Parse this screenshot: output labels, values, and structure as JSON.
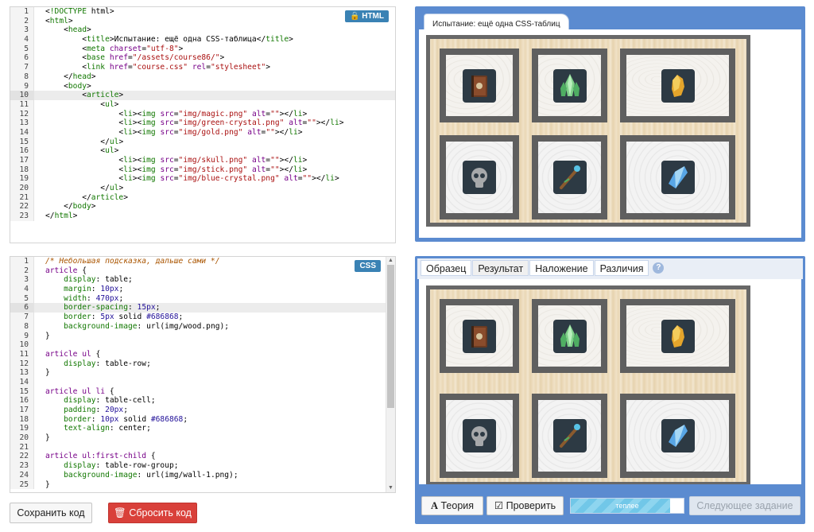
{
  "html_editor": {
    "badge": "HTML",
    "lines": [
      "<!DOCTYPE html>",
      "<html>",
      "    <head>",
      "        <title>Испытание: ещё одна CSS-таблица</title>",
      "        <meta charset=\"utf-8\">",
      "        <base href=\"/assets/course86/\">",
      "        <link href=\"course.css\" rel=\"stylesheet\">",
      "    </head>",
      "    <body>",
      "        <article>",
      "            <ul>",
      "                <li><img src=\"img/magic.png\" alt=\"\"></li>",
      "                <li><img src=\"img/green-crystal.png\" alt=\"\"></li>",
      "                <li><img src=\"img/gold.png\" alt=\"\"></li>",
      "            </ul>",
      "            <ul>",
      "                <li><img src=\"img/skull.png\" alt=\"\"></li>",
      "                <li><img src=\"img/stick.png\" alt=\"\"></li>",
      "                <li><img src=\"img/blue-crystal.png\" alt=\"\"></li>",
      "            </ul>",
      "        </article>",
      "    </body>",
      "</html>"
    ],
    "highlight_line": 10
  },
  "css_editor": {
    "badge": "CSS",
    "lines": [
      "/* Небольшая подсказка, дальше сами */",
      "article {",
      "    display: table;",
      "    margin: 10px;",
      "    width: 470px;",
      "    border-spacing: 15px;",
      "    border: 5px solid #686868;",
      "    background-image: url(img/wood.png);",
      "}",
      "",
      "article ul {",
      "    display: table-row;",
      "}",
      "",
      "article ul li {",
      "    display: table-cell;",
      "    padding: 20px;",
      "    border: 10px solid #686868;",
      "    text-align: center;",
      "}",
      "",
      "article ul:first-child {",
      "    display: table-row-group;",
      "    background-image: url(img/wall-1.png);",
      "}"
    ],
    "highlight_line": 6
  },
  "buttons": {
    "save": "Сохранить код",
    "reset": "Сбросить код",
    "theory": "Теория",
    "check": "Проверить",
    "next": "Следующее задание"
  },
  "preview_top": {
    "tab_title": "Испытание: ещё одна CSS-таблиц"
  },
  "preview_bottom": {
    "tabs": [
      "Образец",
      "Результат",
      "Наложение",
      "Различия"
    ],
    "active_tab": 1,
    "help": "?"
  },
  "progress": {
    "label": "теплее",
    "fraction": 0.88
  },
  "icons": [
    "magic-book-icon",
    "green-crystal-icon",
    "gold-nugget-icon",
    "skull-icon",
    "magic-stick-icon",
    "blue-crystal-icon"
  ],
  "colors": {
    "accent": "#5b8bd0",
    "badge": "#3a82b4",
    "reset": "#d9403a",
    "border": "#686868"
  }
}
